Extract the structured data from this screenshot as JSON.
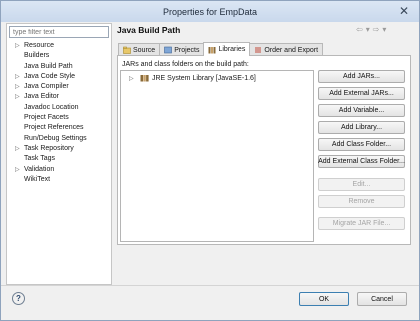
{
  "window": {
    "title": "Properties for EmpData"
  },
  "filter": {
    "placeholder": "type filter text"
  },
  "nav": {
    "items": [
      {
        "label": "Resource",
        "expandable": true
      },
      {
        "label": "Builders",
        "expandable": false
      },
      {
        "label": "Java Build Path",
        "expandable": false
      },
      {
        "label": "Java Code Style",
        "expandable": true
      },
      {
        "label": "Java Compiler",
        "expandable": true
      },
      {
        "label": "Java Editor",
        "expandable": true
      },
      {
        "label": "Javadoc Location",
        "expandable": false
      },
      {
        "label": "Project Facets",
        "expandable": false
      },
      {
        "label": "Project References",
        "expandable": false
      },
      {
        "label": "Run/Debug Settings",
        "expandable": false
      },
      {
        "label": "Task Repository",
        "expandable": true
      },
      {
        "label": "Task Tags",
        "expandable": false
      },
      {
        "label": "Validation",
        "expandable": true
      },
      {
        "label": "WikiText",
        "expandable": false
      }
    ]
  },
  "page": {
    "title": "Java Build Path",
    "tabs": [
      {
        "label": "Source",
        "icon": "source-folder-icon",
        "active": false
      },
      {
        "label": "Projects",
        "icon": "projects-icon",
        "active": false
      },
      {
        "label": "Libraries",
        "icon": "libraries-icon",
        "active": true
      },
      {
        "label": "Order and Export",
        "icon": "order-export-icon",
        "active": false
      }
    ],
    "list_label": "JARs and class folders on the build path:",
    "entries": [
      {
        "label": "JRE System Library [JavaSE-1.6]",
        "icon": "library-icon"
      }
    ],
    "buttons": [
      {
        "label": "Add JARs...",
        "enabled": true
      },
      {
        "label": "Add External JARs...",
        "enabled": true
      },
      {
        "label": "Add Variable...",
        "enabled": true
      },
      {
        "label": "Add Library...",
        "enabled": true
      },
      {
        "label": "Add Class Folder...",
        "enabled": true
      },
      {
        "label": "Add External Class Folder...",
        "enabled": true
      },
      {
        "label": "Edit...",
        "enabled": false
      },
      {
        "label": "Remove",
        "enabled": false
      },
      {
        "label": "Migrate JAR File...",
        "enabled": false
      }
    ]
  },
  "footer": {
    "ok": "OK",
    "cancel": "Cancel"
  },
  "colors": {
    "accent": "#3c7fb1",
    "titlebar": "#c9d8ec"
  }
}
